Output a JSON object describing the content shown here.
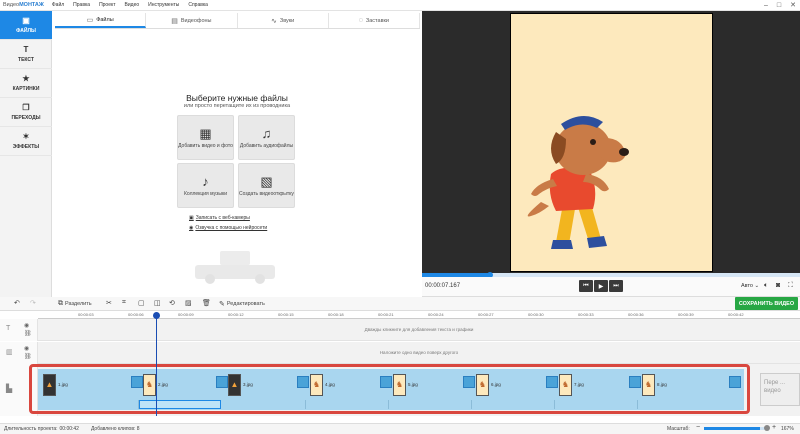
{
  "app": {
    "brand_prefix": "Видео",
    "brand_name": "МОНТАЖ"
  },
  "menu": [
    "Файл",
    "Правка",
    "Проект",
    "Видео",
    "Инструменты",
    "Справка"
  ],
  "window_controls": [
    "–",
    "□",
    "✕"
  ],
  "sidebar": {
    "items": [
      {
        "label": "ФАЙЛЫ",
        "icon": "film-icon",
        "glyph": "▣"
      },
      {
        "label": "ТЕКСТ",
        "icon": "text-icon",
        "glyph": "T"
      },
      {
        "label": "КАРТИНКИ",
        "icon": "star-icon",
        "glyph": "★"
      },
      {
        "label": "ПЕРЕХОДЫ",
        "icon": "transitions-icon",
        "glyph": "❐"
      },
      {
        "label": "ЭФФЕКТЫ",
        "icon": "magic-wand-icon",
        "glyph": "✶"
      }
    ]
  },
  "tabs": [
    {
      "label": "Файлы",
      "icon": "folder-icon",
      "glyph": "▭"
    },
    {
      "label": "Видеофоны",
      "icon": "video-bg-icon",
      "glyph": "▤"
    },
    {
      "label": "Звуки",
      "icon": "sound-icon",
      "glyph": "∿"
    },
    {
      "label": "Заставки",
      "icon": "intro-icon",
      "glyph": "◌"
    }
  ],
  "files": {
    "title": "Выберите нужные файлы",
    "subtitle": "или просто перетащите их из проводника",
    "tiles": [
      {
        "label": "Добавить видео и фото",
        "icon": "add-media-icon",
        "glyph": "▦"
      },
      {
        "label": "Добавить аудиофайлы",
        "icon": "audio-file-icon",
        "glyph": "♫"
      },
      {
        "label": "Коллекция музыки",
        "icon": "music-note-icon",
        "glyph": "♪"
      },
      {
        "label": "Создать видеооткрытку",
        "icon": "postcard-icon",
        "glyph": "▧"
      }
    ],
    "link_webcam": "Записать с веб-камеры",
    "link_ai": "Озвучка с помощью нейросети"
  },
  "player": {
    "timecode": "00:00:07.167",
    "aspect": "Авто",
    "progress": 0.18
  },
  "toolbar": {
    "split_label": "Разделить",
    "edit_label": "Редактировать",
    "save_label": "СОХРАНИТЬ ВИДЕО"
  },
  "ruler": [
    "00:00:03",
    "00:00:06",
    "00:00:09",
    "00:00:12",
    "00:00:15",
    "00:00:18",
    "00:00:21",
    "00:00:24",
    "00:00:27",
    "00:00:30",
    "00:00:33",
    "00:00:36",
    "00:00:39",
    "00:00:42"
  ],
  "timeline": {
    "text_hint": "Дважды кликните для добавления текста и графики",
    "overlay_hint": "Наложите одно видео поверх другого",
    "clips": [
      "1.jpg",
      "2.jpg",
      "3.jpg",
      "4.jpg",
      "5.jpg",
      "6.jpg",
      "7.jpg",
      "8.jpg"
    ],
    "end_placeholder": "Пере ... видео",
    "clip_duration": "3.0"
  },
  "status": {
    "duration_label": "Длительность проекта:",
    "duration_value": "00:00:42",
    "clips_label": "Добавлено клипов: 8",
    "zoom_label": "Масштаб:",
    "zoom_value": "167%"
  },
  "colors": {
    "accent": "#1e88e5",
    "save": "#27a744",
    "track": "#a9d6ef",
    "highlight": "#d9473f",
    "canvas": "#fde9bd"
  }
}
